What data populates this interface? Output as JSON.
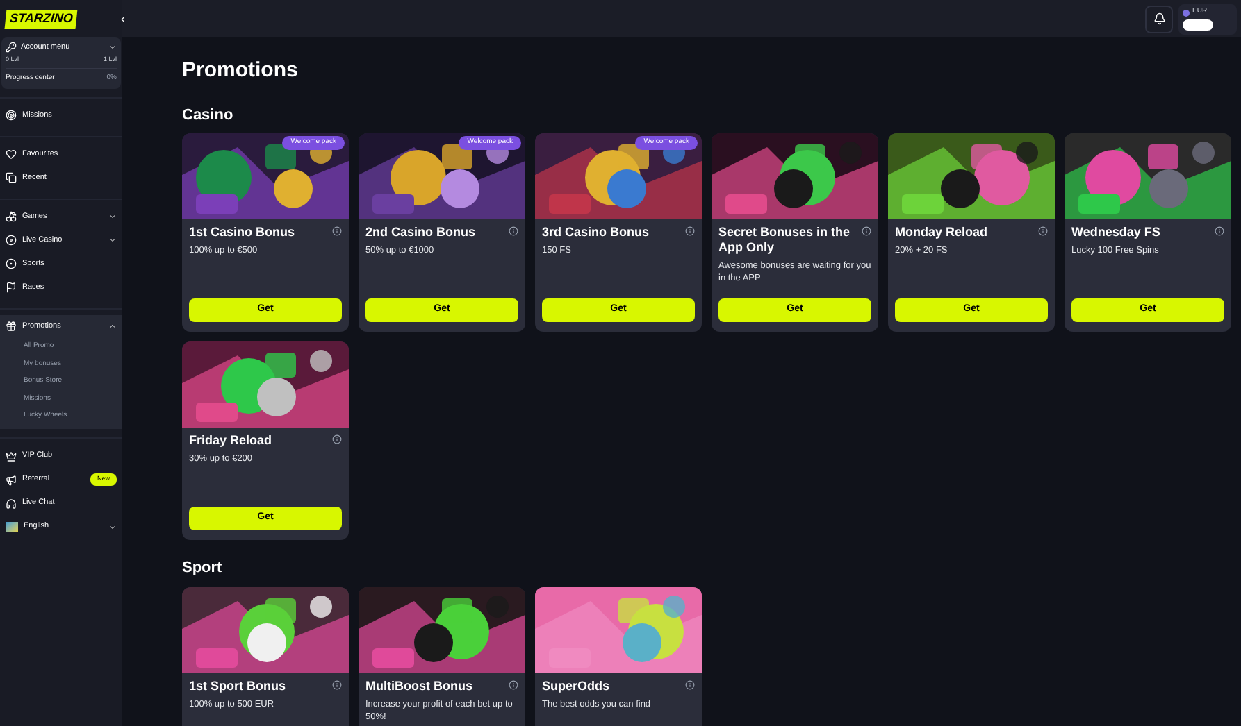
{
  "logo": {
    "text": "STARZINO"
  },
  "account": {
    "title": "Account menu",
    "expanded": false,
    "level_from": "0 Lvl",
    "level_to": "1 Lvl",
    "progress_label": "Progress center",
    "progress_value": "0%"
  },
  "sidebar": {
    "groups": [
      {
        "items": [
          {
            "label": "Missions"
          }
        ]
      },
      {
        "items": [
          {
            "label": "Favourites"
          },
          {
            "label": "Recent"
          }
        ]
      },
      {
        "items": [
          {
            "label": "Games",
            "expanded": false
          },
          {
            "label": "Live Casino",
            "expanded": false
          },
          {
            "label": "Sports"
          },
          {
            "label": "Races"
          }
        ]
      },
      {
        "items": [
          {
            "label": "Promotions",
            "expanded": true,
            "children": [
              {
                "label": "All Promo"
              },
              {
                "label": "My bonuses"
              },
              {
                "label": "Bonus Store"
              },
              {
                "label": "Missions"
              },
              {
                "label": "Lucky Wheels"
              }
            ]
          }
        ]
      },
      {
        "items": [
          {
            "label": "VIP Club"
          },
          {
            "label": "Referral",
            "badge": "New"
          },
          {
            "label": "Live Chat"
          },
          {
            "label": "English",
            "expanded": false
          }
        ]
      }
    ]
  },
  "topbar": {
    "currency": "EUR"
  },
  "page_title": "Promotions",
  "sections": [
    {
      "title": "Casino",
      "cards": [
        {
          "title": "1st Casino Bonus",
          "subtitle": "100% up to €500",
          "badge": "Welcome pack",
          "button": "Get"
        },
        {
          "title": "2nd Casino Bonus",
          "subtitle": "50% up to €1000",
          "badge": "Welcome pack",
          "button": "Get"
        },
        {
          "title": "3rd Casino Bonus",
          "subtitle": "150 FS",
          "badge": "Welcome pack",
          "button": "Get"
        },
        {
          "title": "Secret Bonuses in the App Only",
          "subtitle": "Awesome bonuses are waiting for you in the APP",
          "button": "Get"
        },
        {
          "title": "Monday Reload",
          "subtitle": "20% + 20 FS",
          "button": "Get"
        },
        {
          "title": "Wednesday FS",
          "subtitle": "Lucky 100 Free Spins",
          "button": "Get"
        },
        {
          "title": "Friday Reload",
          "subtitle": "30% up to €200",
          "button": "Get"
        }
      ]
    },
    {
      "title": "Sport",
      "cards": [
        {
          "title": "1st Sport Bonus",
          "subtitle": "100% up to 500 EUR"
        },
        {
          "title": "MultiBoost Bonus",
          "subtitle": "Increase your profit of each bet up to 50%!"
        },
        {
          "title": "SuperOdds",
          "subtitle": "The best odds you can find"
        }
      ]
    }
  ]
}
